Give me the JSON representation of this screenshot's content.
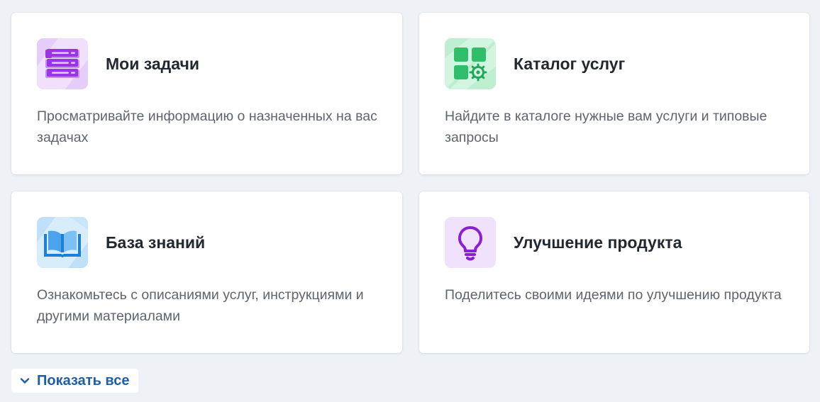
{
  "colors": {
    "page_background": "#eef2f7",
    "card_background": "#ffffff",
    "title_text": "#222831",
    "description_text": "#5d6470",
    "link_text": "#1f5fa8"
  },
  "cards": [
    {
      "title": "Мои задачи",
      "description": "Просматривайте информацию о назначенных на вас задачах",
      "icon": "tasks-list-icon",
      "icon_color": "#9b34e4",
      "icon_background": "#f0e0fb"
    },
    {
      "title": "Каталог услуг",
      "description": "Найдите в каталоге нужные вам услуги и типовые запросы",
      "icon": "service-catalog-icon",
      "icon_color": "#1fa85a",
      "icon_background": "#d2f5df"
    },
    {
      "title": "База знаний",
      "description": "Ознакомьтесь с описаниями услуг, инструкциями и другими материалами",
      "icon": "book-icon",
      "icon_color": "#1d7fd6",
      "icon_background": "#d8edfb"
    },
    {
      "title": "Улучшение продукта",
      "description": "Поделитесь своими идеями по улучшению продукта",
      "icon": "lightbulb-icon",
      "icon_color": "#8a1fd4",
      "icon_background": "#f1e2fb"
    }
  ],
  "show_all": {
    "label": "Показать все",
    "icon": "chevron-down-icon"
  }
}
